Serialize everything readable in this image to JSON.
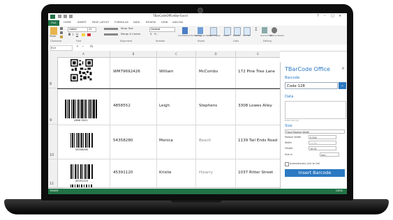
{
  "window": {
    "doc_title": "TBarCodeOfficeBar-Excel",
    "controls": [
      "?",
      "–",
      "□",
      "×"
    ]
  },
  "ribbon": {
    "tabs": [
      "FILE",
      "HOME",
      "INSERT",
      "PAGE LAYOUT",
      "FORMULAS",
      "DATA",
      "REVIEW",
      "VIEW",
      "ADD-INS"
    ],
    "font_name": "Calibri",
    "font_size": "11",
    "wrap_text": "Wrap Text",
    "merge_center": "Merge & Center",
    "number_format": "General",
    "paste_label": "Paste",
    "conditional_formatting": "Conditional Formatting",
    "format_as_table": "Format as Table",
    "cell_styles": "Cell Styles",
    "insert": "Insert",
    "delete": "Delete",
    "format": "Format",
    "sort_filter": "Sort & Filter",
    "find_select": "Find & Select",
    "groups": [
      "Clipboard",
      "Font",
      "Alignment",
      "Number",
      "Styles",
      "Cells",
      "Editing"
    ]
  },
  "formula_bar": {
    "name_box": "B10",
    "fx": "fx"
  },
  "sheet": {
    "columns": [
      "A",
      "B",
      "C",
      "D",
      "E"
    ],
    "rows": [
      {
        "num": "8",
        "code": "WM79692426",
        "first": "William",
        "last": "McCombs",
        "address": "172 Pine Tree Lane",
        "barcode_type": "qr"
      },
      {
        "num": "9",
        "code": "4858552",
        "first": "Leigh",
        "last": "Stephens",
        "address": "3308 Lowes Alley",
        "barcode_type": "linear",
        "barcode_text": "4858 5521"
      },
      {
        "num": "10",
        "code": "54358280",
        "first": "Monica",
        "last": "Beach",
        "address": "1139 Tail Ends Road",
        "barcode_type": "linear",
        "barcode_text": "54358280"
      },
      {
        "num": "11",
        "code": "45391120",
        "first": "Kristie",
        "last": "Hizarry",
        "address": "1037 Ritter Street",
        "barcode_type": "linear",
        "barcode_text": "45391120"
      }
    ],
    "sheet_tab": "Sheet1",
    "status": "READY",
    "zoom": "130%"
  },
  "pane": {
    "title": "TBarCode Office",
    "barcode_label": "Barcode",
    "barcode_type": "Code 128",
    "data_label": "Data",
    "data_hint": "Enter text (2)",
    "size_label": "Size",
    "size_mode": "Fixed Module Width",
    "module_width_label": "Module Width",
    "module_width": "0.254",
    "width_label": "Width",
    "width": "21.59",
    "height_label": "Height",
    "height": "10.01",
    "size_in_label": "Size in",
    "size_in": "mm",
    "link_label": "Automatically Link to Cell",
    "insert_button": "Insert Barcode"
  },
  "colors": {
    "excel_green": "#217346",
    "pane_blue": "#2b79c2"
  }
}
